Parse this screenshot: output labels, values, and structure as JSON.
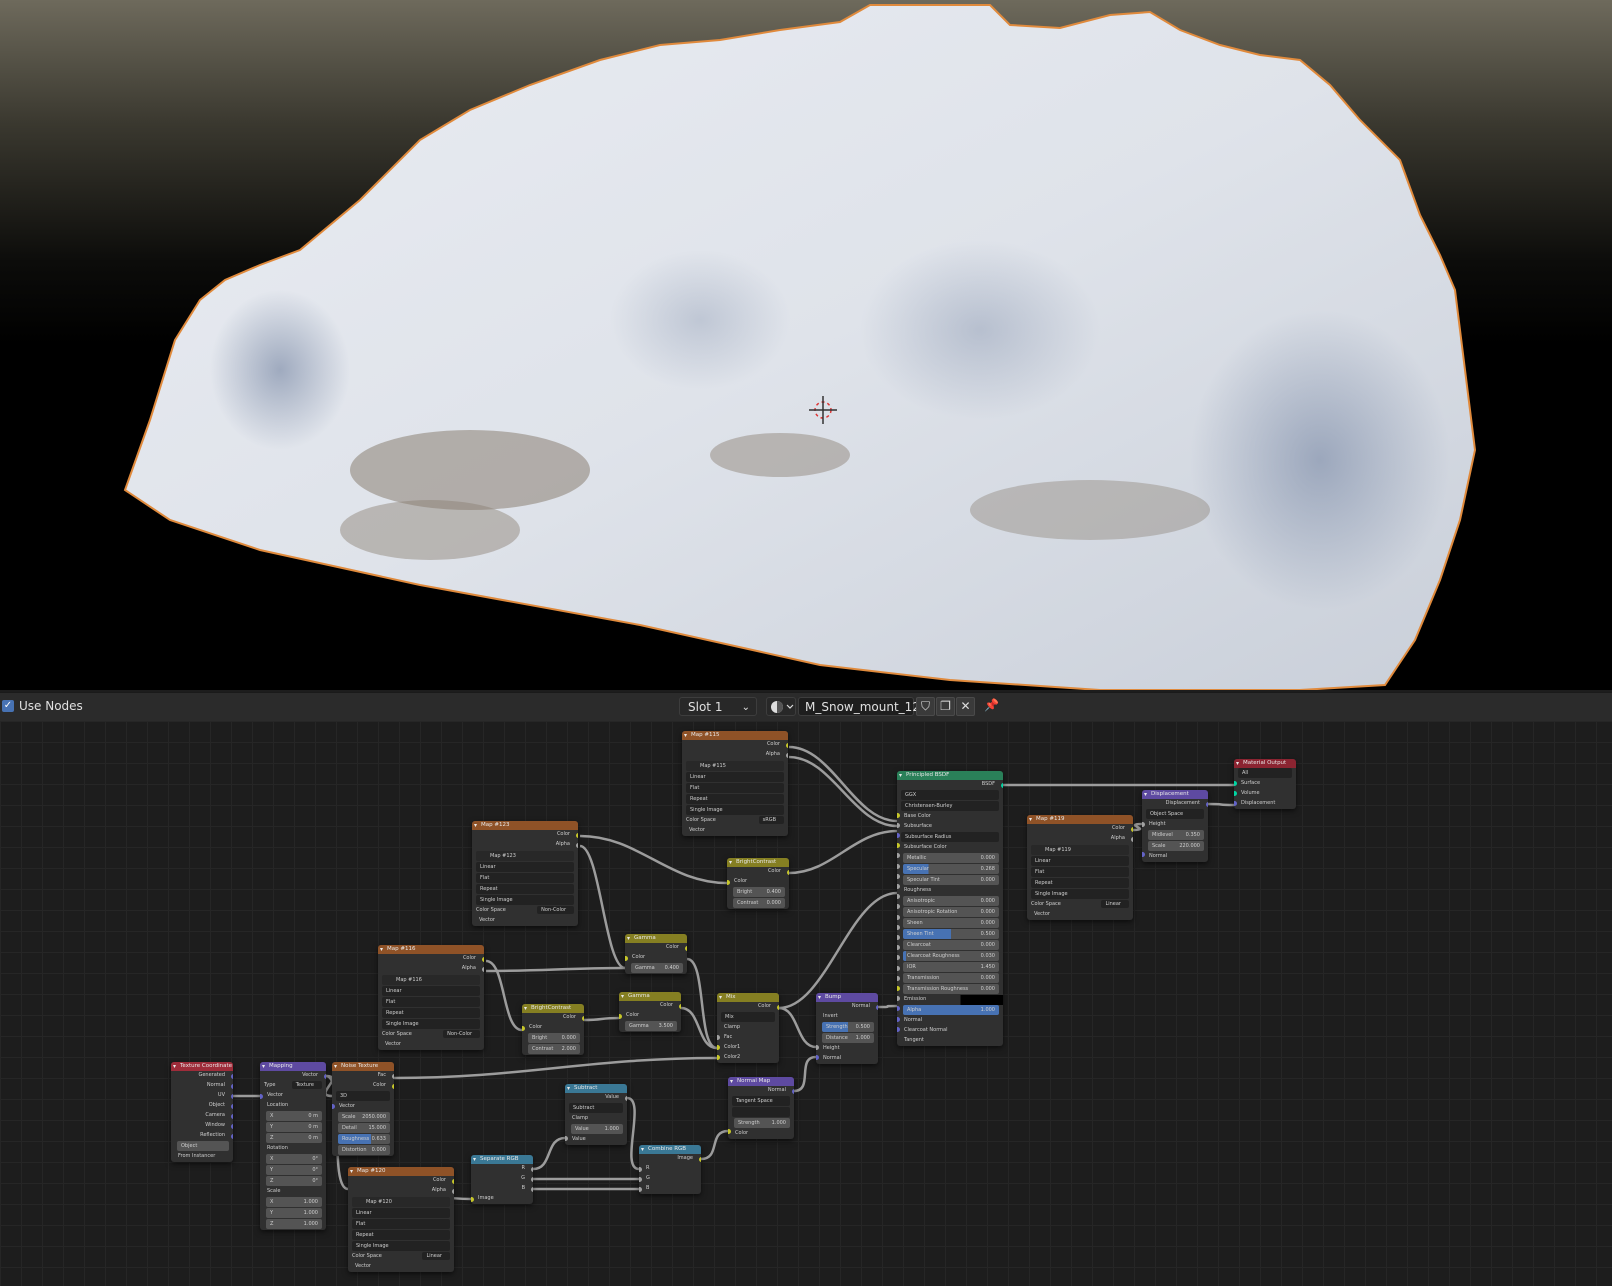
{
  "viewport": {
    "content": "snow-mound-render"
  },
  "header": {
    "use_nodes_label": "Use Nodes",
    "use_nodes_checked": true,
    "slot": "Slot 1",
    "material_name": "M_Snow_mount_12"
  },
  "nodes": {
    "map115": {
      "title": "Map #115",
      "out_color": "Color",
      "out_alpha": "Alpha",
      "image": "Map #115",
      "interp": "Linear",
      "proj": "Flat",
      "ext": "Repeat",
      "src": "Single Image",
      "cs_label": "Color Space",
      "cs": "sRGB",
      "in_vector": "Vector"
    },
    "map123": {
      "title": "Map #123",
      "out_color": "Color",
      "out_alpha": "Alpha",
      "image": "Map #123",
      "interp": "Linear",
      "proj": "Flat",
      "ext": "Repeat",
      "src": "Single Image",
      "cs_label": "Color Space",
      "cs": "Non-Color",
      "in_vector": "Vector"
    },
    "map116": {
      "title": "Map #116",
      "out_color": "Color",
      "out_alpha": "Alpha",
      "image": "Map #116",
      "interp": "Linear",
      "proj": "Flat",
      "ext": "Repeat",
      "src": "Single Image",
      "cs_label": "Color Space",
      "cs": "Non-Color",
      "in_vector": "Vector"
    },
    "map119": {
      "title": "Map #119",
      "out_color": "Color",
      "out_alpha": "Alpha",
      "image": "Map #119",
      "interp": "Linear",
      "proj": "Flat",
      "ext": "Repeat",
      "src": "Single Image",
      "cs_label": "Color Space",
      "cs": "Linear",
      "in_vector": "Vector"
    },
    "map120": {
      "title": "Map #120",
      "out_color": "Color",
      "out_alpha": "Alpha",
      "image": "Map #120",
      "interp": "Linear",
      "proj": "Flat",
      "ext": "Repeat",
      "src": "Single Image",
      "cs_label": "Color Space",
      "cs": "Linear",
      "in_vector": "Vector"
    },
    "bc1": {
      "title": "BrightContrast",
      "out": "Color",
      "in_color": "Color",
      "bright_label": "Bright",
      "bright": "0.400",
      "contrast_label": "Contrast",
      "contrast": "0.000"
    },
    "bc2": {
      "title": "BrightContrast",
      "out": "Color",
      "in_color": "Color",
      "bright_label": "Bright",
      "bright": "0.000",
      "contrast_label": "Contrast",
      "contrast": "2.000"
    },
    "gamma1": {
      "title": "Gamma",
      "out": "Color",
      "in_color": "Color",
      "gamma_label": "Gamma",
      "gamma": "0.400"
    },
    "gamma2": {
      "title": "Gamma",
      "out": "Color",
      "in_color": "Color",
      "gamma_label": "Gamma",
      "gamma": "3.500"
    },
    "mix": {
      "title": "Mix",
      "out": "Color",
      "mode": "Mix",
      "clamp": "Clamp",
      "fac": "Fac",
      "c1": "Color1",
      "c2": "Color2"
    },
    "bump": {
      "title": "Bump",
      "out": "Normal",
      "invert": "Invert",
      "strength_label": "Strength",
      "strength": "0.500",
      "distance_label": "Distance",
      "distance": "1.000",
      "height": "Height",
      "normal": "Normal"
    },
    "normalmap": {
      "title": "Normal Map",
      "out": "Normal",
      "space": "Tangent Space",
      "uv": "",
      "strength_label": "Strength",
      "strength": "1.000",
      "in_color": "Color"
    },
    "bsdf": {
      "title": "Principled BSDF",
      "out": "BSDF",
      "dist": "GGX",
      "sss": "Christensen-Burley",
      "rows": [
        {
          "label": "Base Color",
          "type": "sock"
        },
        {
          "label": "Subsurface",
          "type": "sock"
        },
        {
          "label": "Subsurface Radius",
          "type": "drop"
        },
        {
          "label": "Subsurface Color",
          "type": "sock"
        },
        {
          "label": "Metallic",
          "type": "val",
          "v": "0.000",
          "f": 0
        },
        {
          "label": "Specular",
          "type": "val",
          "v": "0.268",
          "f": 0.268
        },
        {
          "label": "Specular Tint",
          "type": "val",
          "v": "0.000",
          "f": 0
        },
        {
          "label": "Roughness",
          "type": "sock"
        },
        {
          "label": "Anisotropic",
          "type": "val",
          "v": "0.000",
          "f": 0
        },
        {
          "label": "Anisotropic Rotation",
          "type": "val",
          "v": "0.000",
          "f": 0
        },
        {
          "label": "Sheen",
          "type": "val",
          "v": "0.000",
          "f": 0
        },
        {
          "label": "Sheen Tint",
          "type": "val",
          "v": "0.500",
          "f": 0.5
        },
        {
          "label": "Clearcoat",
          "type": "val",
          "v": "0.000",
          "f": 0
        },
        {
          "label": "Clearcoat Roughness",
          "type": "val",
          "v": "0.030",
          "f": 0.03
        },
        {
          "label": "IOR",
          "type": "val",
          "v": "1.450",
          "f": 0
        },
        {
          "label": "Transmission",
          "type": "val",
          "v": "0.000",
          "f": 0
        },
        {
          "label": "Transmission Roughness",
          "type": "val",
          "v": "0.000",
          "f": 0
        },
        {
          "label": "Emission",
          "type": "color"
        },
        {
          "label": "Alpha",
          "type": "val",
          "v": "1.000",
          "f": 1
        },
        {
          "label": "Normal",
          "type": "sock"
        },
        {
          "label": "Clearcoat Normal",
          "type": "sock"
        },
        {
          "label": "Tangent",
          "type": "sock"
        }
      ]
    },
    "disp": {
      "title": "Displacement",
      "out": "Displacement",
      "space": "Object Space",
      "height": "Height",
      "midlevel_label": "Midlevel",
      "midlevel": "0.350",
      "scale_label": "Scale",
      "scale": "220.000",
      "normal": "Normal"
    },
    "matout": {
      "title": "Material Output",
      "target": "All",
      "surface": "Surface",
      "volume": "Volume",
      "displacement": "Displacement"
    },
    "texcoord": {
      "title": "Texture Coordinate",
      "outs": [
        "Generated",
        "Normal",
        "UV",
        "Object",
        "Camera",
        "Window",
        "Reflection"
      ],
      "object_label": "Object",
      "from_inst": "From Instancer"
    },
    "mapping": {
      "title": "Mapping",
      "out": "Vector",
      "type_label": "Type",
      "type": "Texture",
      "vector": "Vector",
      "loc_label": "Location",
      "loc": [
        [
          "X",
          "0 m"
        ],
        [
          "Y",
          "0 m"
        ],
        [
          "Z",
          "0 m"
        ]
      ],
      "rot_label": "Rotation",
      "rot": [
        [
          "X",
          "0°"
        ],
        [
          "Y",
          "0°"
        ],
        [
          "Z",
          "0°"
        ]
      ],
      "scale_label": "Scale",
      "scale": [
        [
          "X",
          "1.000"
        ],
        [
          "Y",
          "1.000"
        ],
        [
          "Z",
          "1.000"
        ]
      ]
    },
    "noise": {
      "title": "Noise Texture",
      "out_fac": "Fac",
      "out_color": "Color",
      "dim": "3D",
      "vector": "Vector",
      "scale_label": "Scale",
      "scale": "2050.000",
      "detail_label": "Detail",
      "detail": "15.000",
      "rough_label": "Roughness",
      "rough": "0.633",
      "dist_label": "Distortion",
      "dist": "0.000"
    },
    "subtract": {
      "title": "Subtract",
      "out": "Value",
      "op": "Subtract",
      "clamp": "Clamp",
      "value_label": "Value",
      "value": "1.000",
      "in_value": "Value"
    },
    "sep": {
      "title": "Separate RGB",
      "r": "R",
      "g": "G",
      "b": "B",
      "image": "Image"
    },
    "comb": {
      "title": "Combine RGB",
      "out": "Image",
      "r": "R",
      "g": "G",
      "b": "B"
    }
  }
}
